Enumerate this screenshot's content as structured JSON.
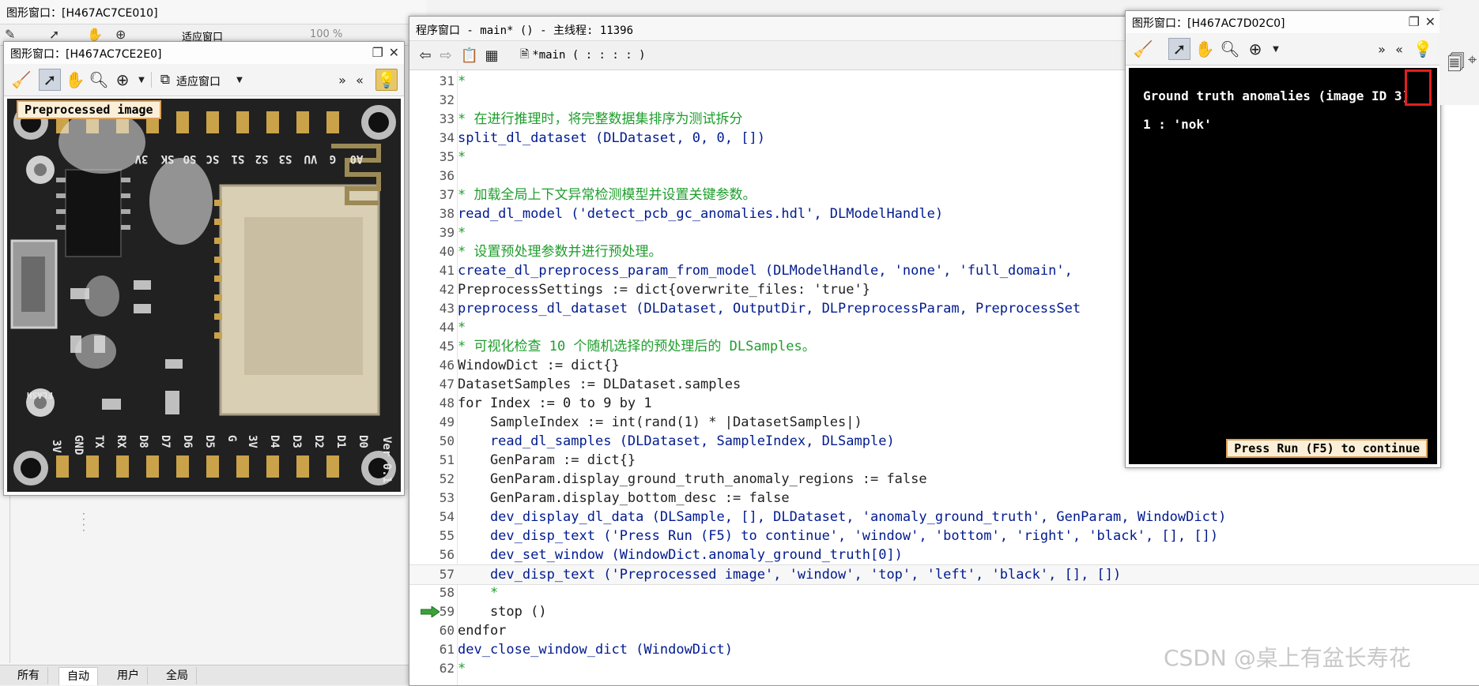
{
  "background_window": {
    "title": "图形窗口：[H467AC7CE010]",
    "fit_label": "适应窗口",
    "zoom_label": "100 %",
    "tabs": [
      "所有",
      "自动",
      "用户",
      "全局"
    ],
    "active_tab": "自动"
  },
  "graphics_window_1": {
    "title": "图形窗口：[H467AC7CE2E0]",
    "fit_label": "适应窗口",
    "overlay_text": "Preprocessed image",
    "pin_labels_top": [
      "3V",
      "SK",
      "SO",
      "SC",
      "S1",
      "S2",
      "S3",
      "VU",
      "G",
      "A0"
    ],
    "pin_labels_bottom": [
      "3V",
      "GND",
      "TX",
      "RX",
      "D8",
      "D7",
      "D6",
      "D5",
      "G",
      "3V",
      "D4",
      "D3",
      "D2",
      "D1",
      "D0"
    ],
    "flash_label": "FLASH",
    "ver_label": "Ver 0.1"
  },
  "program_window": {
    "title": "程序窗口 - main* () - 主线程: 11396",
    "procedure_label": "*main ( : : : : )",
    "lines": [
      {
        "n": "31",
        "t": "*",
        "k": "comment"
      },
      {
        "n": "32",
        "t": "",
        "k": "plain"
      },
      {
        "n": "33",
        "t": "* 在进行推理时，将完整数据集排序为测试拆分",
        "k": "comment"
      },
      {
        "n": "34",
        "t": "split_dl_dataset (DLDataset, 0, 0, [])",
        "k": "op"
      },
      {
        "n": "35",
        "t": "*",
        "k": "comment"
      },
      {
        "n": "36",
        "t": "",
        "k": "plain"
      },
      {
        "n": "37",
        "t": "* 加载全局上下文异常检测模型并设置关键参数。",
        "k": "comment"
      },
      {
        "n": "38",
        "t": "read_dl_model ('detect_pcb_gc_anomalies.hdl', DLModelHandle)",
        "k": "op"
      },
      {
        "n": "39",
        "t": "*",
        "k": "comment"
      },
      {
        "n": "40",
        "t": "* 设置预处理参数并进行预处理。",
        "k": "comment"
      },
      {
        "n": "41",
        "t": "create_dl_preprocess_param_from_model (DLModelHandle, 'none', 'full_domain', ",
        "k": "op"
      },
      {
        "n": "42",
        "t": "PreprocessSettings := dict{overwrite_files: 'true'}",
        "k": "assign"
      },
      {
        "n": "43",
        "t": "preprocess_dl_dataset (DLDataset, OutputDir, DLPreprocessParam, PreprocessSet",
        "k": "op"
      },
      {
        "n": "44",
        "t": "*",
        "k": "comment"
      },
      {
        "n": "45",
        "t": "* 可视化检查 10 个随机选择的预处理后的 DLSamples。",
        "k": "comment"
      },
      {
        "n": "46",
        "t": "WindowDict := dict{}",
        "k": "assign"
      },
      {
        "n": "47",
        "t": "DatasetSamples := DLDataset.samples",
        "k": "assign"
      },
      {
        "n": "48",
        "t": "for Index := 0 to 9 by 1",
        "k": "kw"
      },
      {
        "n": "49",
        "t": "    SampleIndex := int(rand(1) * |DatasetSamples|)",
        "k": "assign"
      },
      {
        "n": "50",
        "t": "    read_dl_samples (DLDataset, SampleIndex, DLSample)",
        "k": "op"
      },
      {
        "n": "51",
        "t": "    GenParam := dict{}",
        "k": "assign"
      },
      {
        "n": "52",
        "t": "    GenParam.display_ground_truth_anomaly_regions := false",
        "k": "assign"
      },
      {
        "n": "53",
        "t": "    GenParam.display_bottom_desc := false",
        "k": "assign"
      },
      {
        "n": "54",
        "t": "    dev_display_dl_data (DLSample, [], DLDataset, 'anomaly_ground_truth', GenParam, WindowDict)",
        "k": "op"
      },
      {
        "n": "55",
        "t": "    dev_disp_text ('Press Run (F5) to continue', 'window', 'bottom', 'right', 'black', [], [])",
        "k": "op"
      },
      {
        "n": "56",
        "t": "    dev_set_window (WindowDict.anomaly_ground_truth[0])",
        "k": "op"
      },
      {
        "n": "57",
        "t": "    dev_disp_text ('Preprocessed image', 'window', 'top', 'left', 'black', [], [])",
        "k": "op"
      },
      {
        "n": "58",
        "t": "    *",
        "k": "comment"
      },
      {
        "n": "59",
        "t": "    stop ()",
        "k": "kw"
      },
      {
        "n": "60",
        "t": "endfor",
        "k": "kw"
      },
      {
        "n": "61",
        "t": "dev_close_window_dict (WindowDict)",
        "k": "op"
      },
      {
        "n": "62",
        "t": "*",
        "k": "comment"
      }
    ],
    "current_line": "59",
    "cursor_line": "57"
  },
  "graphics_window_2": {
    "title": "图形窗口：[H467AC7D02C0]",
    "heading": "Ground truth anomalies (image ID 3)",
    "anomaly_line": "1 : 'nok'",
    "run_prompt": "Press Run (F5) to continue"
  },
  "watermark": "CSDN @桌上有盆长寿花",
  "colors": {
    "comment": "#1e9e2c",
    "operator": "#001a8f",
    "highlight_box": "#e02020",
    "label_bg": "#fcefd8",
    "label_border": "#d9a25c"
  }
}
